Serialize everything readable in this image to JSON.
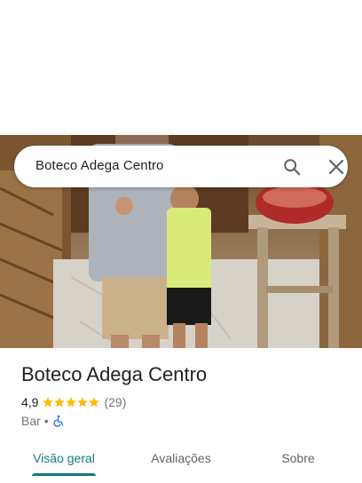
{
  "search": {
    "query": "Boteco Adega Centro"
  },
  "place": {
    "name": "Boteco Adega Centro",
    "rating": "4,9",
    "stars": 5,
    "reviews": "(29)",
    "category": "Bar",
    "separator": "•"
  },
  "tabs": [
    {
      "label": "Visão geral",
      "active": true
    },
    {
      "label": "Avaliações",
      "active": false
    },
    {
      "label": "Sobre",
      "active": false
    }
  ],
  "colors": {
    "accent": "#137c7c",
    "star": "#fbbc04",
    "accessible": "#1a73e8"
  },
  "icons": {
    "search": "search-icon",
    "close": "close-icon",
    "star": "star-icon",
    "accessible": "wheelchair-icon"
  }
}
